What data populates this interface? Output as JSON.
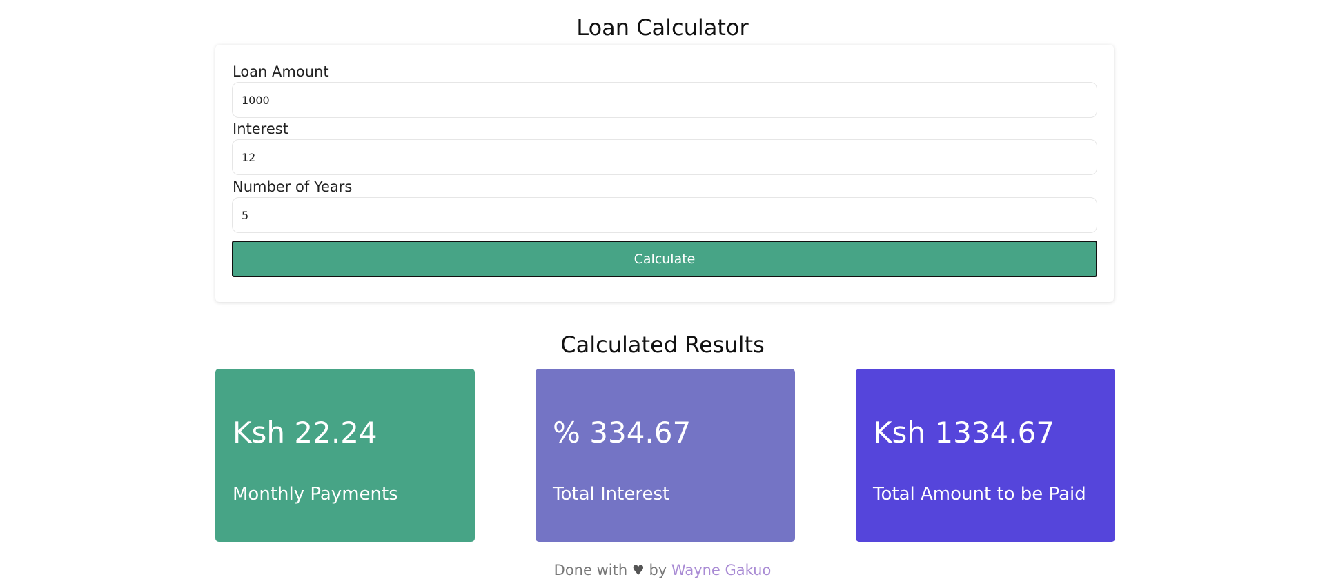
{
  "page": {
    "title": "Loan Calculator"
  },
  "form": {
    "loan_amount": {
      "label": "Loan Amount",
      "value": "1000"
    },
    "interest": {
      "label": "Interest",
      "value": "12"
    },
    "years": {
      "label": "Number of Years",
      "value": "5"
    },
    "calculate_label": "Calculate",
    "button_color": "#47a486"
  },
  "results": {
    "title": "Calculated Results",
    "cards": [
      {
        "value": "Ksh 22.24",
        "label": "Monthly Payments",
        "color": "#47a486"
      },
      {
        "value": "% 334.67",
        "label": "Total Interest",
        "color": "#7474c5"
      },
      {
        "value": "Ksh 1334.67",
        "label": "Total Amount to be Paid",
        "color": "#5545db"
      }
    ]
  },
  "footer": {
    "prefix": "Done with",
    "heart": "♥",
    "middle": "by",
    "author": "Wayne Gakuo",
    "author_color": "#a98bd4"
  }
}
